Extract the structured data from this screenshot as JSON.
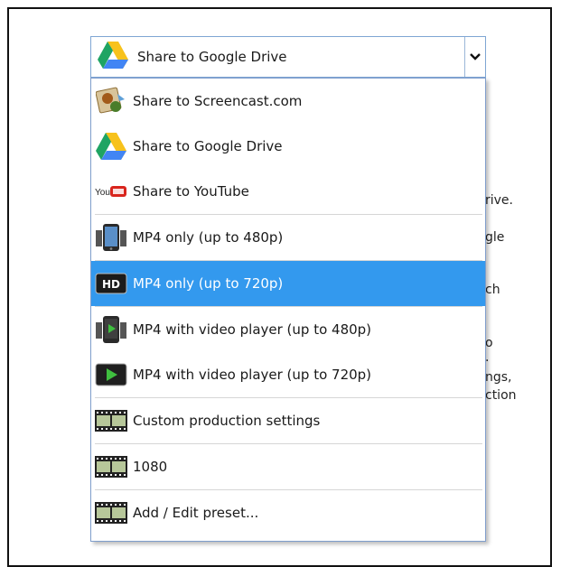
{
  "combo": {
    "selected_label": "Share to Google Drive"
  },
  "dropdown": {
    "items": [
      {
        "label": "Share to Screencast.com",
        "icon": "screencast-icon"
      },
      {
        "label": "Share to Google Drive",
        "icon": "google-drive-icon"
      },
      {
        "label": "Share to YouTube",
        "icon": "youtube-icon",
        "icon_text": "You"
      },
      {
        "label": "MP4 only (up to 480p)",
        "icon": "mobile-phone-icon"
      },
      {
        "label": "MP4 only (up to 720p)",
        "icon": "hd-icon",
        "icon_text": "HD",
        "selected": true
      },
      {
        "label": "MP4 with video player (up to 480p)",
        "icon": "mobile-player-icon"
      },
      {
        "label": "MP4 with video player (up to 720p)",
        "icon": "play-icon"
      },
      {
        "label": "Custom production settings",
        "icon": "film-strip-icon"
      },
      {
        "label": "1080",
        "icon": "film-strip-icon"
      },
      {
        "label": "Add / Edit preset...",
        "icon": "film-strip-icon"
      }
    ]
  },
  "background_fragments": [
    "rive.",
    "gle",
    "ch",
    "o",
    ".",
    "ngs,",
    "ction"
  ],
  "colors": {
    "selection": "#3399ee",
    "combo_border": "#7fa6d4",
    "youtube_red": "#d9251d"
  }
}
